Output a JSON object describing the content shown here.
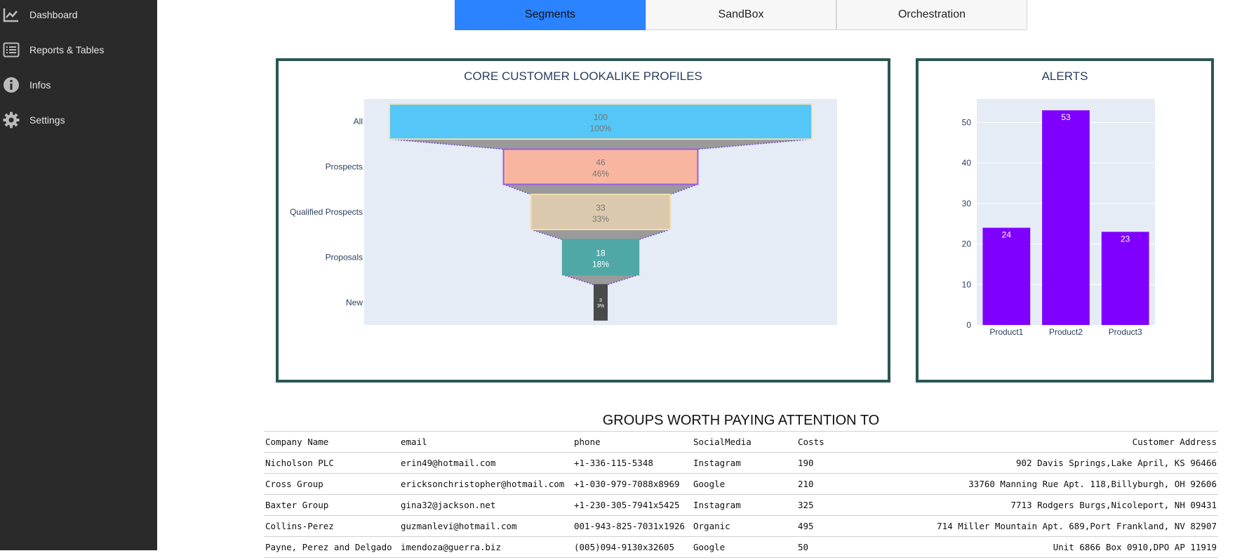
{
  "sidebar": {
    "items": [
      {
        "label": "Dashboard",
        "icon": "chart-line-icon"
      },
      {
        "label": "Reports & Tables",
        "icon": "list-icon"
      },
      {
        "label": "Infos",
        "icon": "info-icon"
      },
      {
        "label": "Settings",
        "icon": "gear-icon"
      }
    ]
  },
  "tabs": [
    {
      "label": "Segments",
      "active": true
    },
    {
      "label": "SandBox",
      "active": false
    },
    {
      "label": "Orchestration",
      "active": false
    }
  ],
  "colors": {
    "sidebar_bg": "#2a2a2a",
    "tab_active": "#2b83ff",
    "card_border": "#2a5654",
    "plot_bg": "#e5ecf6",
    "bar_color": "#7f00ff"
  },
  "chart_data": [
    {
      "type": "funnel",
      "title": "CORE CUSTOMER LOOKALIKE PROFILES",
      "categories": [
        "All",
        "Prospects",
        "Qualified Prospects",
        "Proposals",
        "New"
      ],
      "values": [
        100,
        46,
        33,
        18,
        3
      ],
      "percent_labels": [
        "100%",
        "46%",
        "33%",
        "18%",
        "3%"
      ],
      "colors": [
        "#54c6f7",
        "#f8b6a1",
        "#dbc9ae",
        "#4fa8a6",
        "#4a4a4a"
      ],
      "border_colors": [
        "#f2dfb0",
        "#9b5de5",
        "#f2dfb0",
        "#4fa8a6",
        "#4a4a4a"
      ]
    },
    {
      "type": "bar",
      "title": "ALERTS",
      "categories": [
        "Product1",
        "Product2",
        "Product3"
      ],
      "values": [
        24,
        53,
        23
      ],
      "yticks": [
        0,
        10,
        20,
        30,
        40,
        50
      ],
      "ylim": [
        0,
        55.8
      ]
    }
  ],
  "table": {
    "title": "GROUPS WORTH PAYING ATTENTION TO",
    "columns": [
      "Company Name",
      "email",
      "phone",
      "SocialMedia",
      "Costs",
      "Customer Address"
    ],
    "rows": [
      [
        "Nicholson PLC",
        "erin49@hotmail.com",
        "+1-336-115-5348",
        "Instagram",
        "190",
        "902 Davis Springs,Lake April, KS 96466"
      ],
      [
        "Cross Group",
        "ericksonchristopher@hotmail.com",
        "+1-030-979-7088x8969",
        "Google",
        "210",
        "33760 Manning Rue Apt. 118,Billyburgh, OH 92606"
      ],
      [
        "Baxter Group",
        "gina32@jackson.net",
        "+1-230-305-7941x5425",
        "Instagram",
        "325",
        "7713 Rodgers Burgs,Nicoleport, NH 09431"
      ],
      [
        "Collins-Perez",
        "guzmanlevi@hotmail.com",
        "001-943-825-7031x1926",
        "Organic",
        "495",
        "714 Miller Mountain Apt. 689,Port Frankland, NV 82907"
      ],
      [
        "Payne, Perez and Delgado",
        "imendoza@guerra.biz",
        "(005)094-9130x32605",
        "Google",
        "50",
        "Unit 6866 Box 0910,DPO AP 11919"
      ]
    ]
  }
}
